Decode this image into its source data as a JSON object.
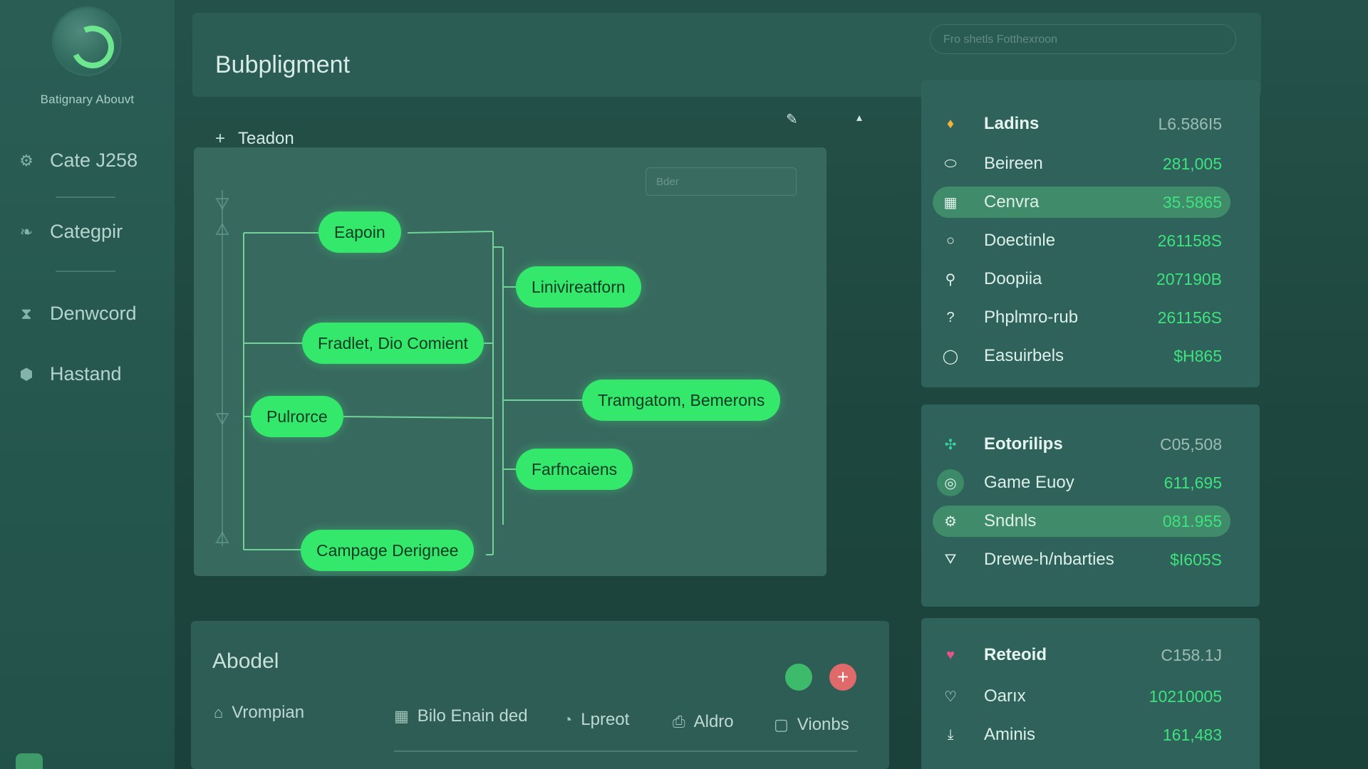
{
  "sidebar": {
    "brand": "Batignary Abouvt",
    "items": [
      {
        "label": "Cate J258",
        "icon": "gear-icon"
      },
      {
        "label": "Categpir",
        "icon": "leaf-icon"
      },
      {
        "label": "Denwcord",
        "icon": "hourglass-icon"
      },
      {
        "label": "Hastand",
        "icon": "shield-icon"
      }
    ]
  },
  "header": {
    "title": "Bubpligment",
    "search_placeholder": "Fro shetls Fotthexroon"
  },
  "flow": {
    "heading": "Teadon",
    "filter_placeholder": "Bder",
    "nodes": [
      "Eapoin",
      "Fradlet, Dio Comient",
      "Pulrorce",
      "Campage Derignee",
      "Linivireatforn",
      "Tramgatom, Bemerons",
      "Farfncaiens"
    ]
  },
  "bottom": {
    "title": "Abodel",
    "tabs": [
      {
        "label": "Vrompian",
        "icon": "home-icon"
      },
      {
        "label": "Bilo Enain ded",
        "icon": "building-icon"
      },
      {
        "label": "Lpreot",
        "icon": "clock-icon"
      },
      {
        "label": "Aldro",
        "icon": "printer-icon"
      },
      {
        "label": "Vionbs",
        "icon": "chat-icon"
      }
    ],
    "colors": {
      "green_button": "#3dbb6a",
      "red_button": "#e06a6a"
    }
  },
  "panels": [
    {
      "rows": [
        {
          "label": "Ladins",
          "value": "L6.586I5",
          "icon": "flame-icon",
          "head": true
        },
        {
          "label": "Beireen",
          "value": "281,005",
          "icon": "ring-icon"
        },
        {
          "label": "Cenvra",
          "value": "35.5865",
          "icon": "grid-icon",
          "active": true
        },
        {
          "label": "Doectinle",
          "value": "261158S",
          "icon": "circle-icon"
        },
        {
          "label": "Doopiia",
          "value": "207190B",
          "icon": "pin-icon"
        },
        {
          "label": "Phplmro-rub",
          "value": "261156S",
          "icon": "question-icon"
        },
        {
          "label": "Easuirbels",
          "value": "$H865",
          "icon": "circle-icon"
        }
      ]
    },
    {
      "rows": [
        {
          "label": "Eotorilips",
          "value": "C05,508",
          "icon": "network-icon",
          "head": true
        },
        {
          "label": "Game Euoy",
          "value": "611,695",
          "icon": "target-icon"
        },
        {
          "label": "Sndnls",
          "value": "081.955",
          "icon": "gear-icon",
          "active": true
        },
        {
          "label": "Drewe-h/nbarties",
          "value": "$I605S",
          "icon": "funnel-icon"
        }
      ]
    },
    {
      "rows": [
        {
          "label": "Reteoid",
          "value": "C158.1J",
          "icon": "paint-icon",
          "head": true
        },
        {
          "label": "Oarıx",
          "value": "10210005",
          "icon": "heart-icon"
        },
        {
          "label": "Aminis",
          "value": "161,483",
          "icon": "download-icon"
        }
      ]
    }
  ]
}
